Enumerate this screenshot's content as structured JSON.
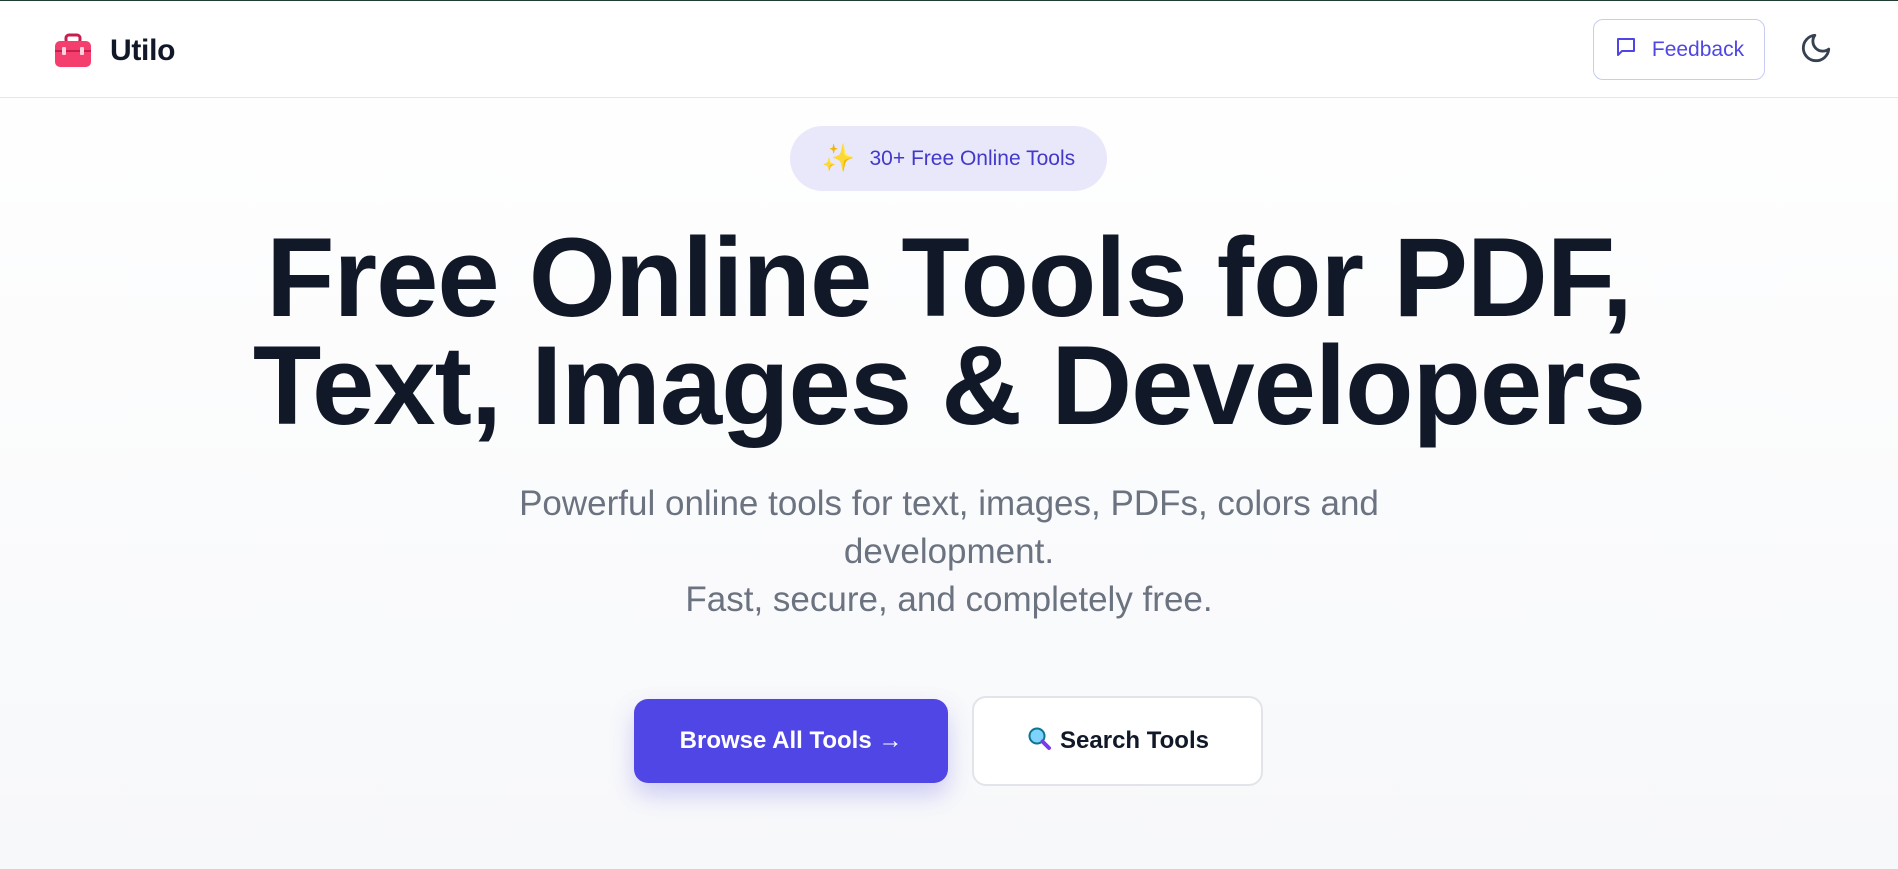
{
  "header": {
    "brand_name": "Utilo",
    "feedback_label": "Feedback"
  },
  "hero": {
    "badge_label": "30+ Free Online Tools",
    "title_line1": "Free Online Tools for PDF,",
    "title_line2": "Text, Images & Developers",
    "subtitle_line1": "Powerful online tools for text, images, PDFs, colors and development.",
    "subtitle_line2": "Fast, secure, and completely free.",
    "browse_label": "Browse All Tools →",
    "search_label": "Search Tools"
  },
  "icons": {
    "brand": "toolbox-icon",
    "feedback": "message-square-icon",
    "theme": "moon-icon",
    "badge": "sparkles-icon",
    "search": "magnifying-glass-icon"
  },
  "colors": {
    "accent": "#4f46e5",
    "badge_bg": "#e9e8fb",
    "brand_icon": "#f43f6e",
    "title": "#111827",
    "subtitle": "#6b7280"
  }
}
